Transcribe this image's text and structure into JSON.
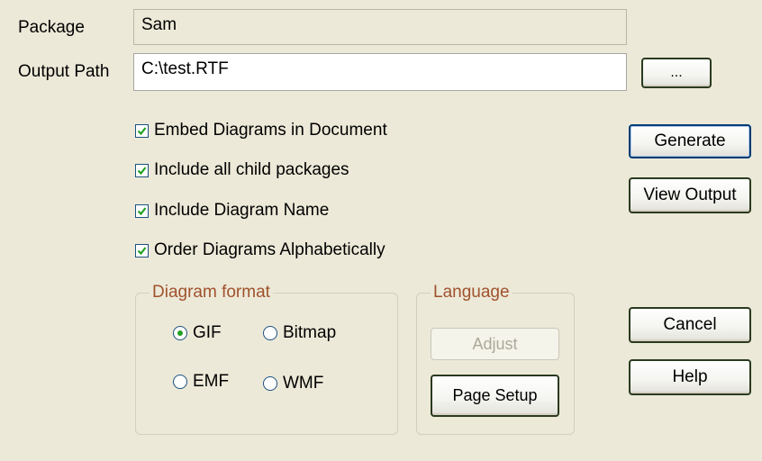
{
  "package": {
    "label": "Package",
    "value": "Sam"
  },
  "output_path": {
    "label": "Output Path",
    "value": "C:\\test.RTF",
    "browse_label": "..."
  },
  "options": [
    {
      "label": "Embed Diagrams in Document",
      "checked": true
    },
    {
      "label": "Include all child packages",
      "checked": true
    },
    {
      "label": "Include Diagram Name",
      "checked": true
    },
    {
      "label": "Order Diagrams Alphabetically",
      "checked": true
    }
  ],
  "diagram_format": {
    "title": "Diagram format",
    "options": [
      {
        "label": "GIF",
        "selected": true
      },
      {
        "label": "Bitmap",
        "selected": false
      },
      {
        "label": "EMF",
        "selected": false
      },
      {
        "label": "WMF",
        "selected": false
      }
    ]
  },
  "language": {
    "title": "Language",
    "adjust_label": "Adjust",
    "page_setup_label": "Page Setup"
  },
  "buttons": {
    "generate": "Generate",
    "view_output": "View Output",
    "cancel": "Cancel",
    "help": "Help"
  }
}
